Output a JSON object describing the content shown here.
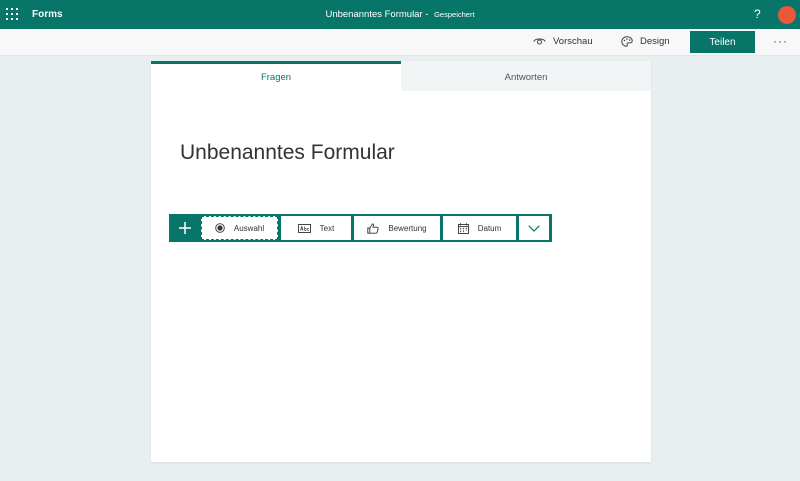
{
  "topbar": {
    "app_name": "Forms",
    "form_title": "Unbenanntes Formular",
    "separator": "-",
    "save_status": "Gespeichert",
    "help": "?",
    "accent_color": "#077568",
    "avatar_color": "#e8583a"
  },
  "commandbar": {
    "preview_label": "Vorschau",
    "design_label": "Design",
    "share_label": "Teilen",
    "more_label": "···"
  },
  "tabs": {
    "questions": "Fragen",
    "responses": "Antworten"
  },
  "form": {
    "title": "Unbenanntes Formular"
  },
  "add_question": {
    "items": [
      {
        "label": "Auswahl",
        "icon": "radio-icon"
      },
      {
        "label": "Text",
        "icon": "text-icon"
      },
      {
        "label": "Bewertung",
        "icon": "thumbs-up-icon"
      },
      {
        "label": "Datum",
        "icon": "calendar-icon"
      }
    ]
  }
}
